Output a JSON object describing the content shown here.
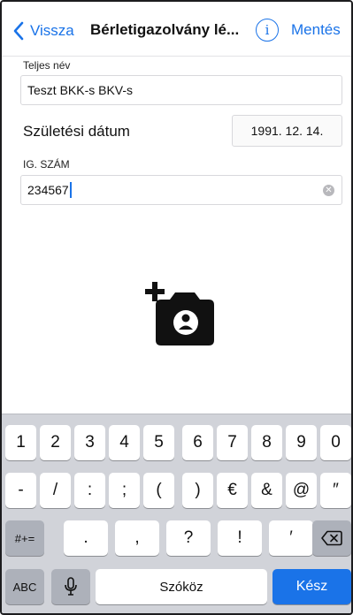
{
  "nav": {
    "back_label": "Vissza",
    "title": "Bérletigazolvány lé...",
    "info_glyph": "i",
    "save_label": "Mentés",
    "back_icon": "chevron-left-icon",
    "info_icon": "info-circle-icon"
  },
  "form": {
    "full_name_label": "Teljes név",
    "full_name_value": "Teszt BKK-s BKV-s",
    "dob_label": "Születési dátum",
    "dob_value": "1991. 12. 14.",
    "id_label": "IG. SZÁM",
    "id_value": "234567",
    "clear_icon": "clear-circle-icon"
  },
  "photo": {
    "icon": "add-photo-camera-icon"
  },
  "keyboard": {
    "row1": [
      "1",
      "2",
      "3",
      "4",
      "5",
      "6",
      "7",
      "8",
      "9",
      "0"
    ],
    "row2": [
      "-",
      "/",
      ":",
      ";",
      "(",
      ")",
      "€",
      "&",
      "@",
      "″"
    ],
    "row3_left": "#+=",
    "row3": [
      ".",
      ",",
      "?",
      "!",
      "′"
    ],
    "row3_delete_icon": "backspace-icon",
    "abc_label": "ABC",
    "mic_icon": "microphone-icon",
    "space_label": "Szóköz",
    "return_label": "Kész"
  },
  "colors": {
    "accent": "#1a73e8",
    "keyboard_bg": "#d1d3d9"
  }
}
